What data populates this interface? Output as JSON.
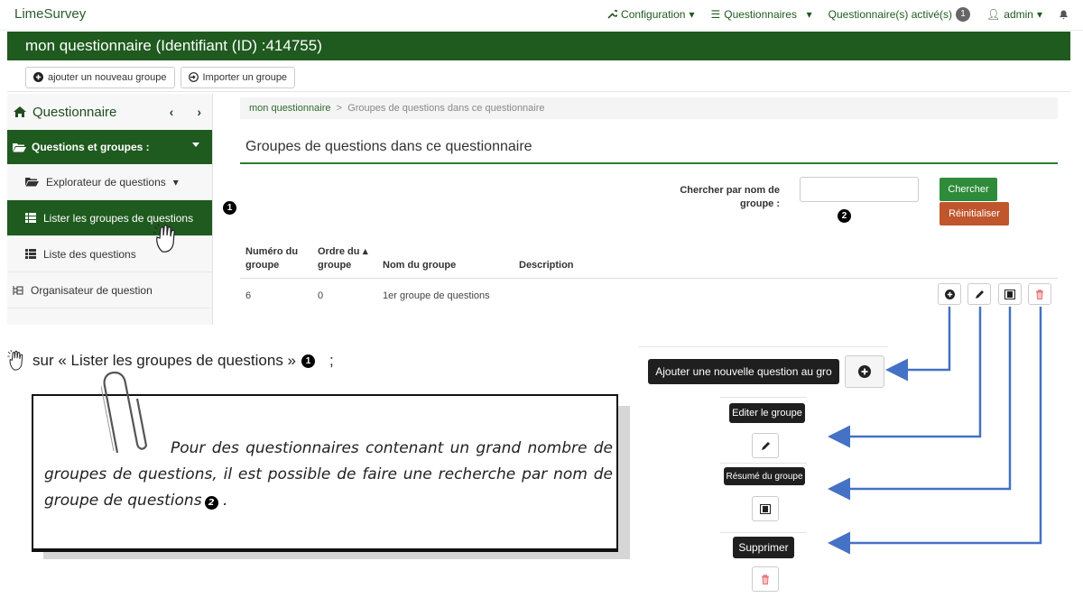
{
  "app": {
    "brand": "LimeSurvey"
  },
  "topnav": {
    "configuration": "Configuration",
    "questionnaires": "Questionnaires",
    "active_label": "Questionnaire(s) activé(s)",
    "active_count": "1",
    "user": "admin"
  },
  "survey": {
    "title": "mon questionnaire (Identifiant (ID) :414755)"
  },
  "toolbar": {
    "add_group": "ajouter un nouveau groupe",
    "import_group": "Importer un groupe"
  },
  "sidebar": {
    "heading": "Questionnaire",
    "section": "Questions et groupes :",
    "items": [
      {
        "label": "Explorateur de questions"
      },
      {
        "label": "Lister les groupes de questions"
      },
      {
        "label": "Liste des questions"
      },
      {
        "label": "Organisateur de question"
      }
    ]
  },
  "breadcrumb": {
    "root": "mon questionnaire",
    "sep": ">",
    "current": "Groupes de questions dans ce questionnaire"
  },
  "page": {
    "title": "Groupes de questions dans ce questionnaire"
  },
  "search": {
    "label": "Chercher par nom de groupe :",
    "value": "",
    "search_button": "Chercher",
    "reset_button": "Réinitialiser"
  },
  "table": {
    "headers": [
      "Numéro du groupe",
      "Ordre du groupe",
      "Nom du groupe",
      "Description"
    ],
    "rows": [
      {
        "id": "6",
        "order": "0",
        "name": "1er groupe de questions",
        "description": ""
      }
    ]
  },
  "markers": {
    "one": "1",
    "two": "2"
  },
  "instruction": {
    "text": "sur « Lister les groupes de questions »",
    "suffix": ";"
  },
  "note": {
    "text": "Pour des questionnaires contenant un grand nombre de groupes de questions, il est possible de faire une recherche par nom de groupe de questions",
    "suffix": "."
  },
  "tooltips": {
    "add_question": "Ajouter une nouvelle question au gro",
    "edit_group": "Editer le groupe",
    "group_summary": "Résumé du groupe",
    "delete": "Supprimer"
  },
  "colors": {
    "brand_green": "#1f5a1f",
    "button_green": "#2e8b3a",
    "reset_orange": "#c0562d",
    "arrow_blue": "#4472c4",
    "delete_red": "#e57373"
  }
}
